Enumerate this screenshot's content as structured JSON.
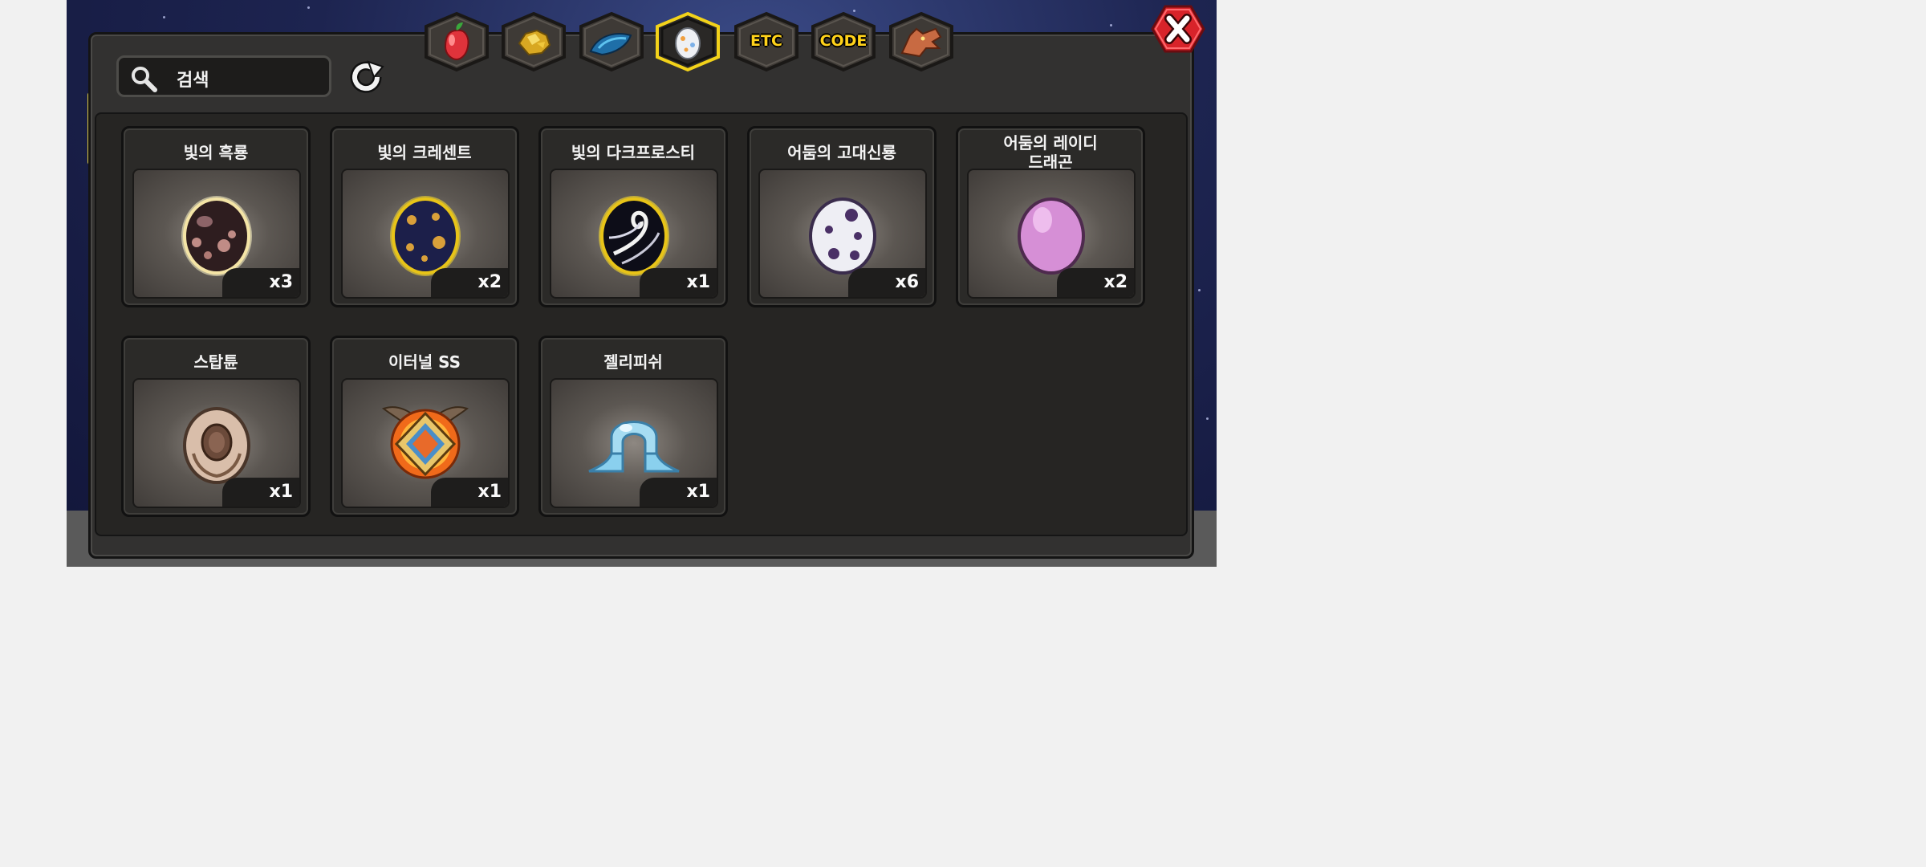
{
  "search": {
    "placeholder": "검색",
    "icon": "magnifier-icon"
  },
  "refresh": {
    "icon": "refresh-icon"
  },
  "tabs": [
    {
      "name": "fruit",
      "icon": "red-fruit-icon",
      "selected": false
    },
    {
      "name": "gold",
      "icon": "gold-ore-icon",
      "selected": false
    },
    {
      "name": "scale",
      "icon": "blue-scale-icon",
      "selected": false
    },
    {
      "name": "egg",
      "icon": "egg-icon",
      "selected": true
    },
    {
      "name": "etc",
      "label": "ETC",
      "selected": false
    },
    {
      "name": "code",
      "label": "CODE",
      "selected": false
    },
    {
      "name": "dragon",
      "icon": "dragon-head-icon",
      "selected": false
    }
  ],
  "close": {
    "icon": "close-x-icon",
    "color": "#d8232a"
  },
  "items": [
    {
      "name": "빛의 흑룡",
      "qty": "x3",
      "icon": "dark-brown-spotted-egg-icon"
    },
    {
      "name": "빛의 크레센트",
      "qty": "x2",
      "icon": "navy-gold-spotted-egg-icon"
    },
    {
      "name": "빛의 다크프로스티",
      "qty": "x1",
      "icon": "black-swirl-egg-icon"
    },
    {
      "name": "어둠의 고대신룡",
      "qty": "x6",
      "icon": "white-purple-spotted-egg-icon"
    },
    {
      "name": "어둠의 레이디\n드래곤",
      "qty": "x2",
      "icon": "pink-egg-icon"
    },
    {
      "name": "스탑튠",
      "qty": "x1",
      "icon": "laurel-emblem-egg-icon"
    },
    {
      "name": "이터널 SS",
      "qty": "x1",
      "icon": "winged-crest-icon"
    },
    {
      "name": "젤리피쉬",
      "qty": "x1",
      "icon": "jellyfish-icon"
    }
  ],
  "colors": {
    "selected_tab_border": "#f2d21a",
    "panel": "#323130"
  }
}
